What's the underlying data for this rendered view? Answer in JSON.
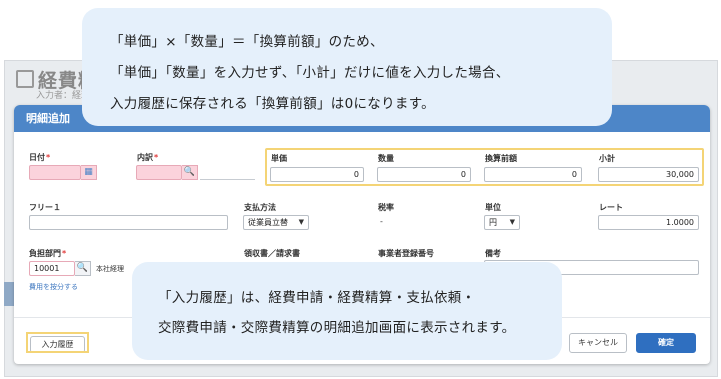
{
  "background": {
    "title": "経費精",
    "subtitle": "入力者：経理..."
  },
  "dialog": {
    "title": "明細追加",
    "fields": {
      "date_label": "日付",
      "breakdown_label": "内訳",
      "unit_price_label": "単価",
      "unit_price_value": "0",
      "quantity_label": "数量",
      "quantity_value": "0",
      "converted_amount_label": "換算前額",
      "converted_amount_value": "0",
      "subtotal_label": "小計",
      "subtotal_value": "30,000",
      "free1_label": "フリー１",
      "payment_method_label": "支払方法",
      "payment_method_value": "従業員立替",
      "tax_rate_label": "税率",
      "tax_rate_value": "-",
      "unit_label": "単位",
      "unit_value": "円",
      "rate_label": "レート",
      "rate_value": "1.0000",
      "department_label": "負担部門",
      "department_code": "10001",
      "department_name": "本社経理",
      "receipt_label": "領収書／請求書",
      "registration_label": "事業者登録番号",
      "remarks_label": "備考",
      "allocate_link": "費用を按分する"
    },
    "buttons": {
      "history": "入力履歴",
      "cancel": "キャンセル",
      "confirm": "確定"
    }
  },
  "callouts": {
    "top": [
      "「単価」×「数量」＝「換算前額」のため、",
      "「単価」「数量」を入力せず、「小計」だけに値を入力した場合、",
      "入力履歴に保存される「換算前額」は0になります。"
    ],
    "bottom": [
      "「入力履歴」は、経費申請・経費精算・支払依頼・",
      "交際費申請・交際費精算の明細追加画面に表示されます。"
    ]
  },
  "colors": {
    "header": "#4d86c8",
    "highlight": "#f4d476",
    "callout": "#e5f0fb",
    "required": "#e03c3c",
    "primary_button": "#2f6fc0"
  }
}
